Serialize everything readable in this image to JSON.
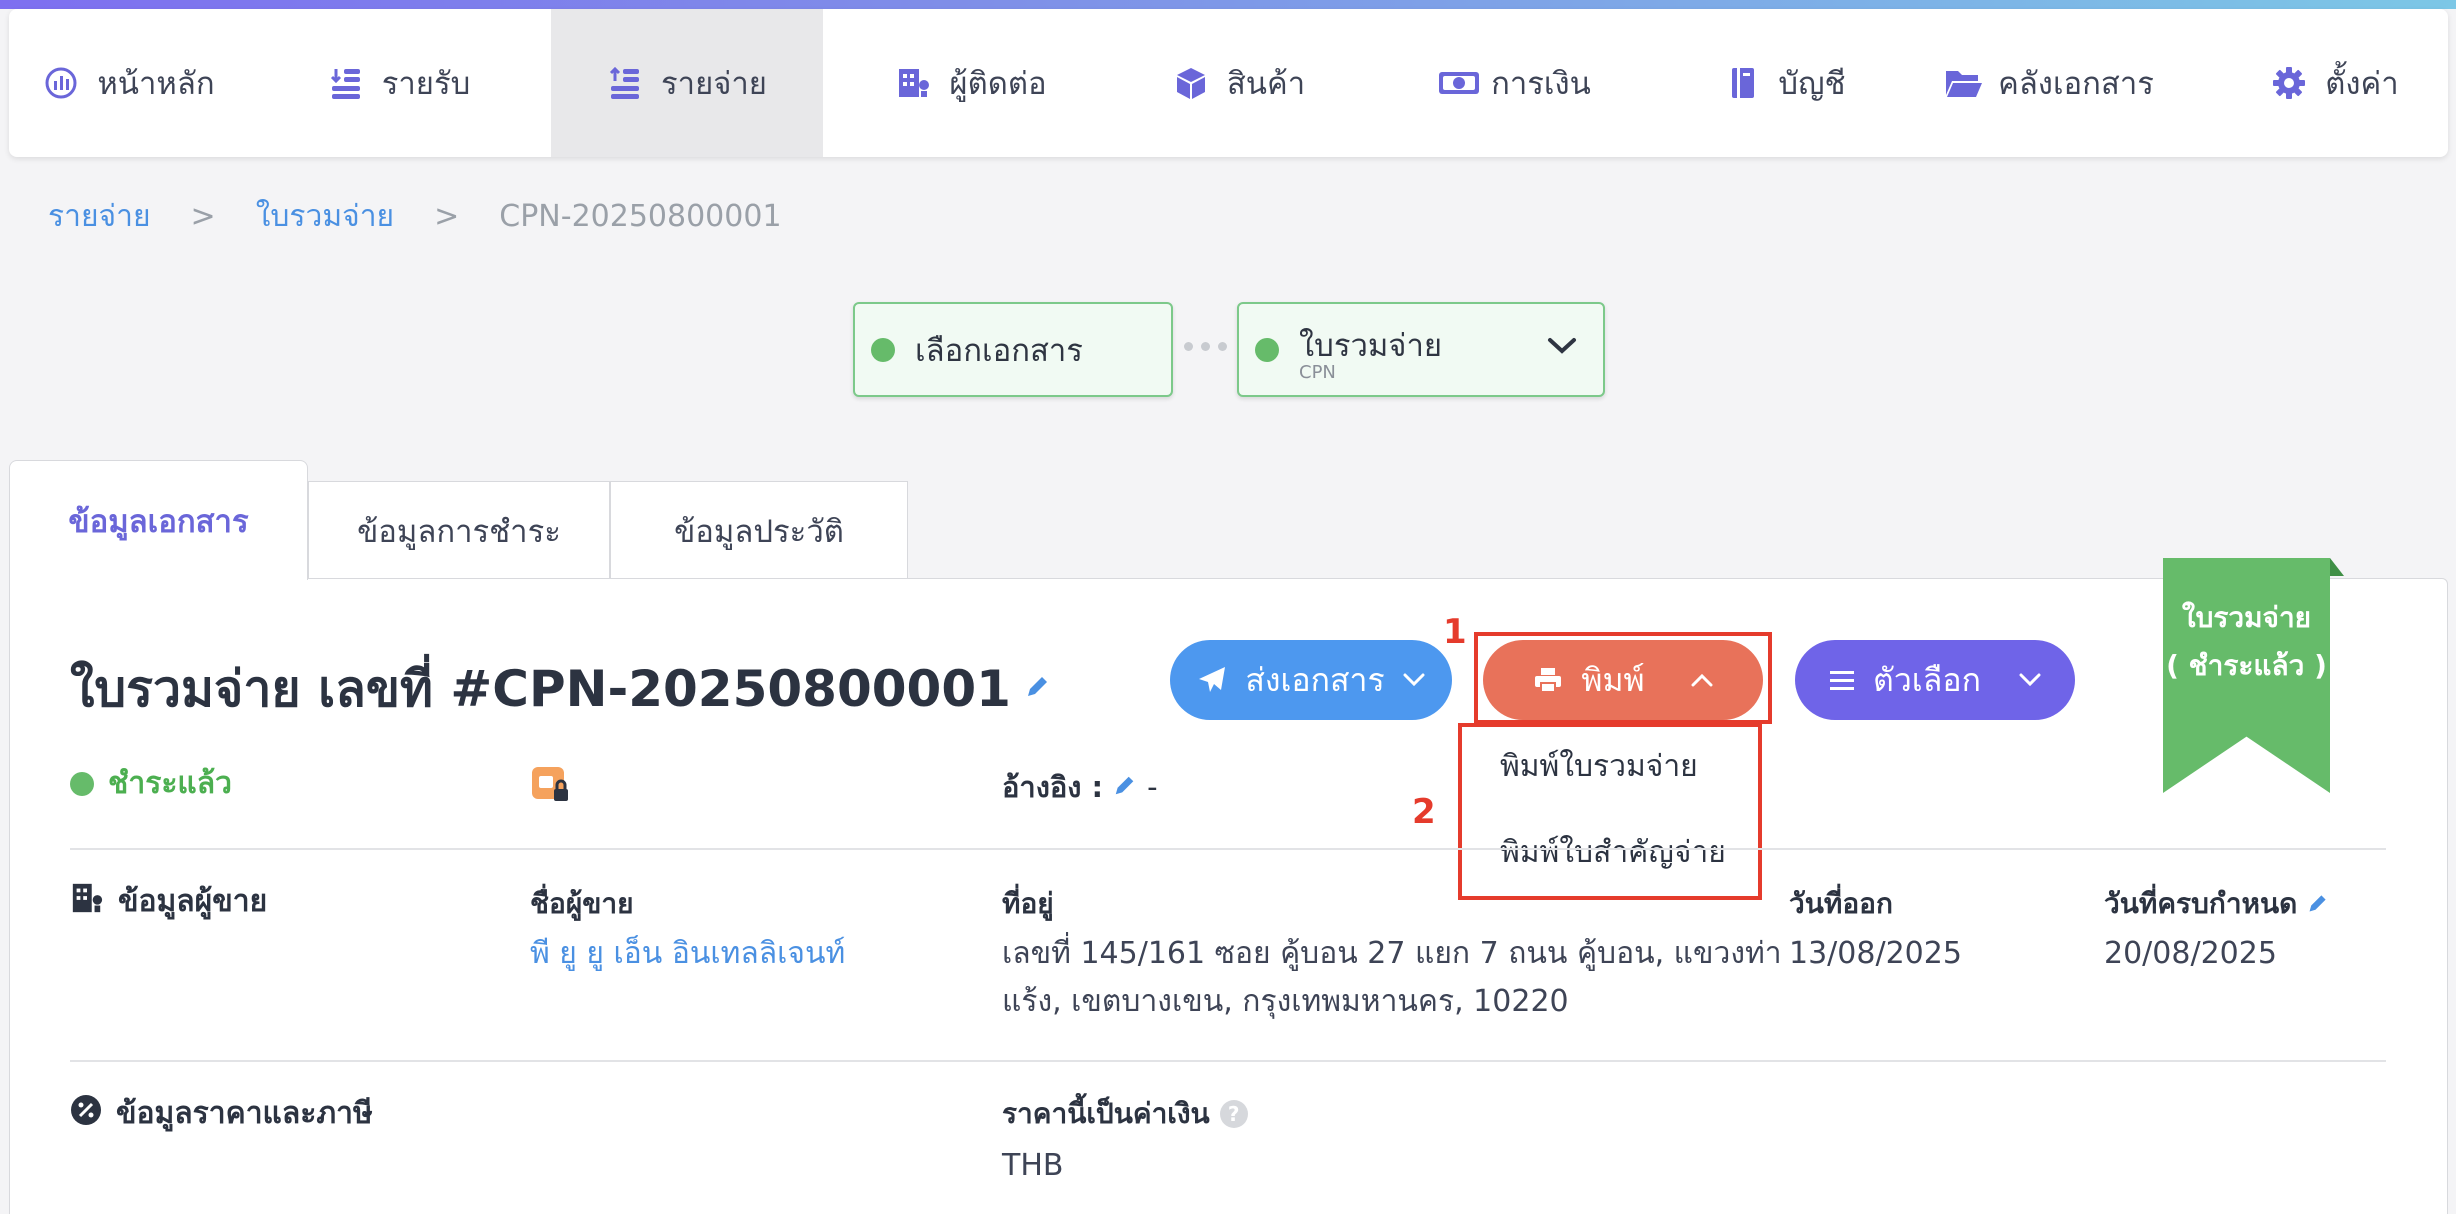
{
  "nav": {
    "items": [
      {
        "label": "หน้าหลัก",
        "icon": "dashboard-icon"
      },
      {
        "label": "รายรับ",
        "icon": "income-icon"
      },
      {
        "label": "รายจ่าย",
        "icon": "expense-icon"
      },
      {
        "label": "ผู้ติดต่อ",
        "icon": "contacts-icon"
      },
      {
        "label": "สินค้า",
        "icon": "product-box-icon"
      },
      {
        "label": "การเงิน",
        "icon": "money-icon"
      },
      {
        "label": "บัญชี",
        "icon": "ledger-book-icon"
      },
      {
        "label": "คลังเอกสาร",
        "icon": "folder-icon"
      },
      {
        "label": "ตั้งค่า",
        "icon": "gear-icon"
      }
    ],
    "active_index": 2
  },
  "breadcrumb": {
    "root": "รายจ่าย",
    "section": "ใบรวมจ่าย",
    "current": "CPN-20250800001",
    "separator": ">"
  },
  "steps": {
    "first": {
      "label": "เลือกเอกสาร"
    },
    "second": {
      "label": "ใบรวมจ่าย",
      "sub": "CPN"
    }
  },
  "tabs": [
    "ข้อมูลเอกสาร",
    "ข้อมูลการชำระ",
    "ข้อมูลประวัติ"
  ],
  "document": {
    "title": "ใบรวมจ่าย เลขที่ #CPN-20250800001",
    "status": "ชำระแล้ว",
    "ref_label": "อ้างอิง :",
    "ref_value": "-"
  },
  "actions": {
    "send": "ส่งเอกสาร",
    "print": "พิมพ์",
    "options": "ตัวเลือก"
  },
  "print_menu": [
    "พิมพ์ใบรวมจ่าย",
    "พิมพ์ใบสำคัญจ่าย"
  ],
  "annotations": {
    "one": "1",
    "two": "2"
  },
  "ribbon": {
    "line1": "ใบรวมจ่าย",
    "line2": "( ชำระแล้ว )"
  },
  "vendor": {
    "section_title": "ข้อมูลผู้ขาย",
    "name_label": "ชื่อผู้ขาย",
    "name": "พี ยู ยู เอ็น อินเทลลิเจนท์",
    "address_label": "ที่อยู่",
    "address_line1": "เลขที่ 145/161 ซอย คู้บอน 27 แยก 7 ถนน คู้บอน, แขวงท่า",
    "address_line2": "แร้ง, เขตบางเขน, กรุงเทพมหานคร, 10220",
    "issue_label": "วันที่ออก",
    "issue_date": "13/08/2025",
    "due_label": "วันที่ครบกำหนด",
    "due_date": "20/08/2025"
  },
  "pricing": {
    "section_title": "ข้อมูลราคาและภาษี",
    "currency_label": "ราคานี้เป็นค่าเงิน",
    "currency": "THB"
  },
  "colors": {
    "accent": "#6a66d9",
    "link": "#4a90e2",
    "success": "#66bb6a",
    "print_button": "#e8725a",
    "send_button": "#4d98ef",
    "options_button": "#6f64e8",
    "highlight": "#e53b2c"
  }
}
